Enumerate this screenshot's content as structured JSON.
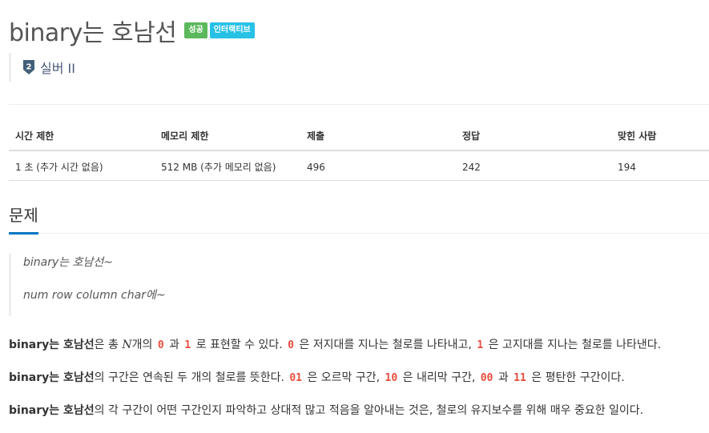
{
  "problem": {
    "title": "binary는 호남선",
    "labels": [
      {
        "text": "성공",
        "color": "#5cb85c"
      },
      {
        "text": "인터랙티브",
        "color": "#27c1e6"
      }
    ],
    "tier": {
      "icon": "silver-tier-icon",
      "number": "2",
      "text": "실버 II",
      "color": "#4a5a78"
    }
  },
  "info_table": {
    "headers": [
      "시간 제한",
      "메모리 제한",
      "제출",
      "정답",
      "맞힌 사람"
    ],
    "row": [
      "1 초 (추가 시간 없음)",
      "512 MB (추가 메모리 없음)",
      "496",
      "242",
      "194"
    ]
  },
  "section": {
    "title": "문제",
    "accent": "#0076c0"
  },
  "quote": {
    "lines": [
      "binary는 호남선~",
      "num row column char에~"
    ]
  },
  "paragraphs": {
    "p1": {
      "bold": "binary는 호남선",
      "t1": "은 총 ",
      "math": "N",
      "t2": "개의 ",
      "c1": "0",
      "t3": " 과 ",
      "c2": "1",
      "t4": " 로 표현할 수 있다. ",
      "c3": "0",
      "t5": " 은 저지대를 지나는 철로를 나타내고, ",
      "c4": "1",
      "t6": " 은 고지대를 지나는 철로를 나타낸다."
    },
    "p2": {
      "bold": "binary는 호남선",
      "t1": "의 구간은 연속된 두 개의 철로를 뜻한다. ",
      "c1": "01",
      "t2": " 은 오르막 구간, ",
      "c2": "10",
      "t3": " 은 내리막 구간, ",
      "c3": "00",
      "t4": " 과 ",
      "c4": "11",
      "t5": " 은 평탄한 구간이다."
    },
    "p3": {
      "bold": "binary는 호남선",
      "t1": "의 각 구간이 어떤 구간인지 파악하고 상대적 많고 적음을 알아내는 것은, 철로의 유지보수를 위해 매우 중요한 일이다."
    }
  },
  "colors": {
    "code": "#e74c3c",
    "text": "#333333",
    "success": "#5cb85c",
    "info": "#27c1e6"
  }
}
